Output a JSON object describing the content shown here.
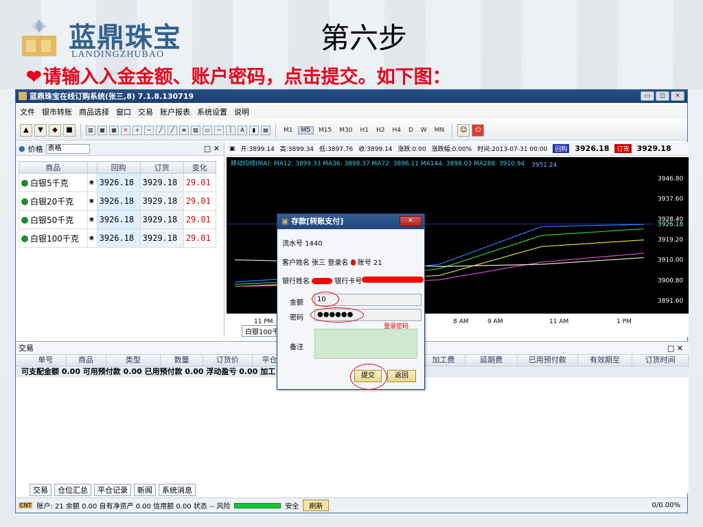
{
  "slide": {
    "brand_cn": "蓝鼎珠宝",
    "brand_en": "LANDINGZHUBAO",
    "title": "第六步",
    "instruction": "请输入入金金额、账户密码，点击提交。如下图：",
    "heart_icon": "heart-icon"
  },
  "window": {
    "title": "蓝鼎珠宝在线订购系统(张三,8) 7.1.8.130719",
    "menu": [
      "文件",
      "银市转账",
      "商品选择",
      "窗口",
      "交易",
      "账户报表",
      "系统设置",
      "说明"
    ],
    "timeframes": [
      "M1",
      "M5",
      "M15",
      "M30",
      "H1",
      "H2",
      "H4",
      "D",
      "W",
      "MN"
    ],
    "active_timeframe": "M5"
  },
  "price_panel": {
    "tab_label": "价格",
    "tab_input": "表格",
    "columns": [
      "商品",
      "回购",
      "订货",
      "变化"
    ],
    "rows": [
      {
        "name": "白银5千克",
        "bid": "3926.18",
        "ask": "3929.18",
        "change": "29.01"
      },
      {
        "name": "白银20千克",
        "bid": "3926.18",
        "ask": "3929.18",
        "change": "29.01"
      },
      {
        "name": "白银50千克",
        "bid": "3926.18",
        "ask": "3929.18",
        "change": "29.01"
      },
      {
        "name": "白银100千克",
        "bid": "3926.18",
        "ask": "3929.18",
        "change": "29.01"
      }
    ]
  },
  "chart": {
    "info": {
      "open": "开:3899.14",
      "high": "高:3899.34",
      "low": "低:3897.76",
      "close": "收:3899.14",
      "change": "涨跌:0.00",
      "pct": "涨跌幅:0.00%",
      "time": "时间:2013-07-31 00:00",
      "bid_label": "回购",
      "bid_price": "3926.18",
      "ask_label": "订货",
      "ask_price": "3929.18"
    },
    "ma_legend": "移动均线(MA): MA12: 3899.33 MA36: 3898.37 MA72: 3896.11 MA144: 3898.03 MA288: 3910.94",
    "peak_label": "3951.24",
    "y_labels": [
      "3946.80",
      "3937.60",
      "3928.40",
      "3919.20",
      "3910.00",
      "3900.80",
      "3891.60"
    ],
    "current_price": "3926.18",
    "x_labels": [
      "11 PM",
      "8 AM",
      "9 AM",
      "11 AM",
      "1 PM"
    ],
    "tab": "白银100千克"
  },
  "chart_data": {
    "type": "line",
    "title": "",
    "xlabel": "",
    "ylabel": "",
    "ylim": [
      3887,
      3952
    ],
    "categories": [
      "11 PM",
      "8 AM",
      "9 AM",
      "11 AM",
      "1 PM"
    ],
    "series": [
      {
        "name": "MA12",
        "values": [
          3900,
          3903,
          3908,
          3925,
          3926
        ]
      },
      {
        "name": "MA36",
        "values": [
          3899,
          3901,
          3906,
          3921,
          3924
        ]
      },
      {
        "name": "MA72",
        "values": [
          3898,
          3900,
          3903,
          3916,
          3919
        ]
      },
      {
        "name": "MA144",
        "values": [
          3898,
          3899,
          3901,
          3909,
          3913
        ]
      },
      {
        "name": "MA288",
        "values": [
          3910,
          3909,
          3907,
          3908,
          3911
        ]
      }
    ]
  },
  "trade_panel": {
    "title": "交易",
    "columns": [
      "单号",
      "商品",
      "类型",
      "数量",
      "订货价",
      "平仓价",
      "加工费",
      "延期费",
      "已用预付款",
      "有效期至",
      "订货时间"
    ],
    "summary": "可支配金额 0.00  可用预付款 0.00  已用预付款 0.00  浮动盈亏 0.00  加工",
    "bottom_tabs": [
      "交易",
      "仓位汇总",
      "平仓记录",
      "新闻",
      "系统消息"
    ]
  },
  "status": {
    "text": "账户: 21 余额 0.00 自有净资产 0.00 信用额 0.00 状态 -- 风险",
    "safe": "安全",
    "refresh": "刷新",
    "right": "0/0.00%"
  },
  "dialog": {
    "title": "存款[转账支付]",
    "serial_label": "流水号",
    "serial_value": "1440",
    "customer_line": "客户姓名 张三  登录名",
    "account_label": "账号 21",
    "bank_name_label": "银行姓名",
    "bank_card_label": "银行卡号",
    "amount_label": "金额",
    "amount_value": "10",
    "password_label": "密码",
    "password_value": "●●●●●●",
    "password_hint": "登录密码",
    "note_label": "备注",
    "submit": "提交",
    "back": "返回"
  },
  "colors": {
    "brand": "#34628f",
    "instruction": "#e8001a",
    "price_up": "#e00000",
    "chart_bg": "#000000"
  }
}
